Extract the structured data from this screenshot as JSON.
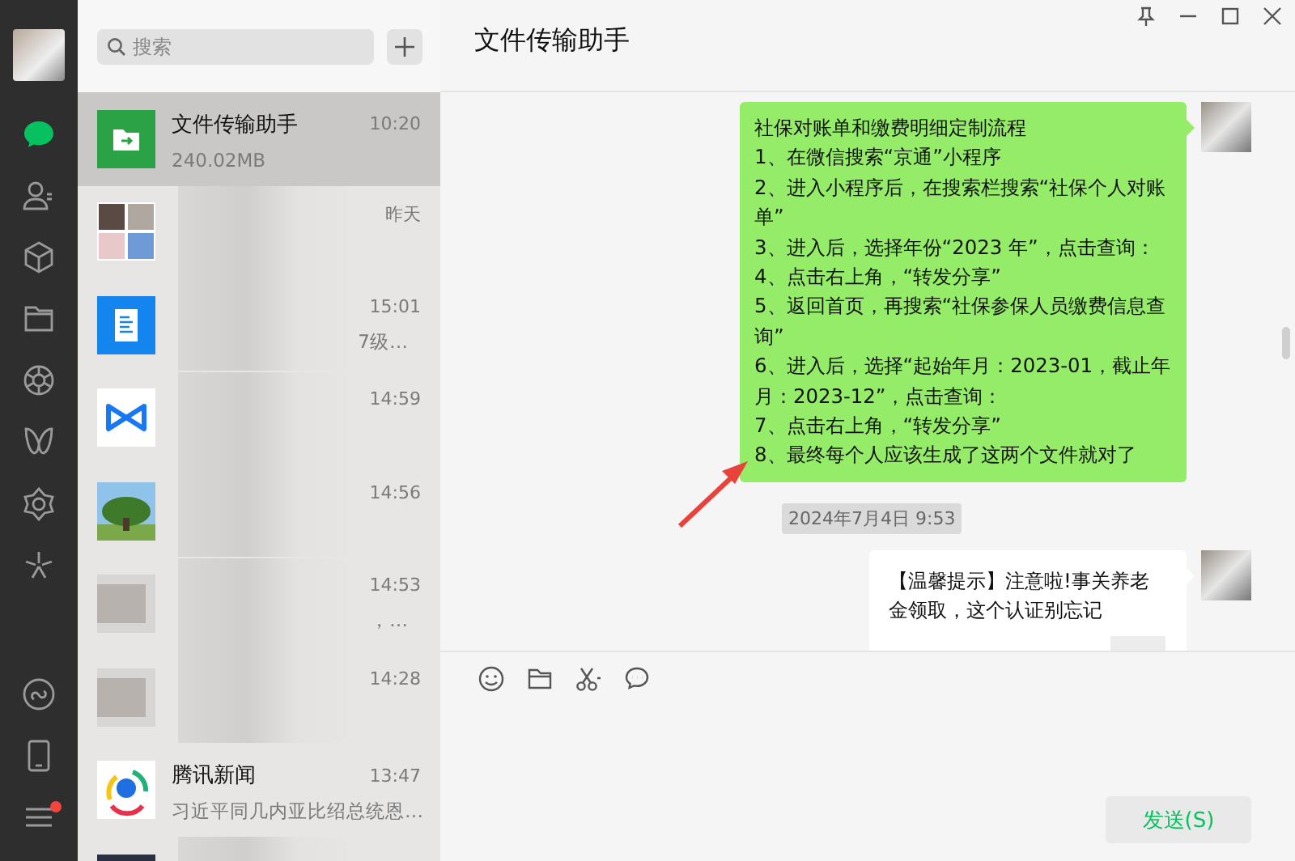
{
  "nav": {
    "items": [
      {
        "kind": "chat",
        "selected": true,
        "dot": false
      },
      {
        "kind": "contacts",
        "selected": false,
        "dot": false
      },
      {
        "kind": "cube",
        "selected": false,
        "dot": false
      },
      {
        "kind": "folder",
        "selected": false,
        "dot": false
      },
      {
        "kind": "aperture",
        "selected": false,
        "dot": false
      },
      {
        "kind": "butterfly",
        "selected": false,
        "dot": false
      },
      {
        "kind": "flower",
        "selected": false,
        "dot": false
      },
      {
        "kind": "sparkle",
        "selected": false,
        "dot": false
      }
    ],
    "bottom_items": [
      {
        "kind": "miniapp",
        "selected": false,
        "dot": false
      },
      {
        "kind": "phone",
        "selected": false,
        "dot": false
      },
      {
        "kind": "menu",
        "selected": false,
        "dot": true
      }
    ]
  },
  "chat_list": {
    "search": {
      "placeholder": "搜索"
    },
    "chats": [
      {
        "kind": "file",
        "name": "文件传输助手",
        "time": "10:20",
        "preview": "240.02MB",
        "selected": true,
        "blurred": false
      },
      {
        "kind": "group",
        "time": "昨天",
        "selected": false,
        "blurred": true
      },
      {
        "kind": "doc",
        "time": "15:01",
        "preview": "7级…",
        "selected": false,
        "blurred": true
      },
      {
        "kind": "link",
        "time": "14:59",
        "selected": false,
        "blurred": true
      },
      {
        "kind": "tree",
        "time": "14:56",
        "selected": false,
        "blurred": true
      },
      {
        "kind": "blur",
        "time": "14:53",
        "preview": "，…",
        "selected": false,
        "blurred": true
      },
      {
        "kind": "blur",
        "time": "14:28",
        "selected": false,
        "blurred": true
      },
      {
        "kind": "news",
        "name": "腾讯新闻",
        "time": "13:47",
        "preview": "习近平同几内亚比绍总统恩…",
        "selected": false,
        "blurred": false
      },
      {
        "kind": "dark",
        "selected": false,
        "blurred": true
      }
    ]
  },
  "chat": {
    "title": "文件传输助手",
    "messages": [
      {
        "kind": "text",
        "lines": [
          "社保对账单和缴费明细定制流程",
          "1、在微信搜索“京通”小程序",
          "2、进入小程序后，在搜索栏搜索“社保个人对账单”",
          "3、进入后，选择年份“2023 年”，点击查询：",
          "4、点击右上角，“转发分享”",
          "5、返回首页，再搜索“社保参保人员缴费信息查询”",
          "6、进入后，选择“起始年月：2023-01，截止年月：2023-12”，点击查询：",
          "7、点击右上角，“转发分享”",
          "8、最终每个人应该生成了这两个文件就对了"
        ]
      },
      {
        "kind": "time",
        "text": "2024年7月4日 9:53"
      },
      {
        "kind": "card",
        "lines": [
          "【温馨提示】注意啦!事关养老金领取，这个认证别忘记"
        ]
      }
    ],
    "send_button": "发送(S)"
  }
}
